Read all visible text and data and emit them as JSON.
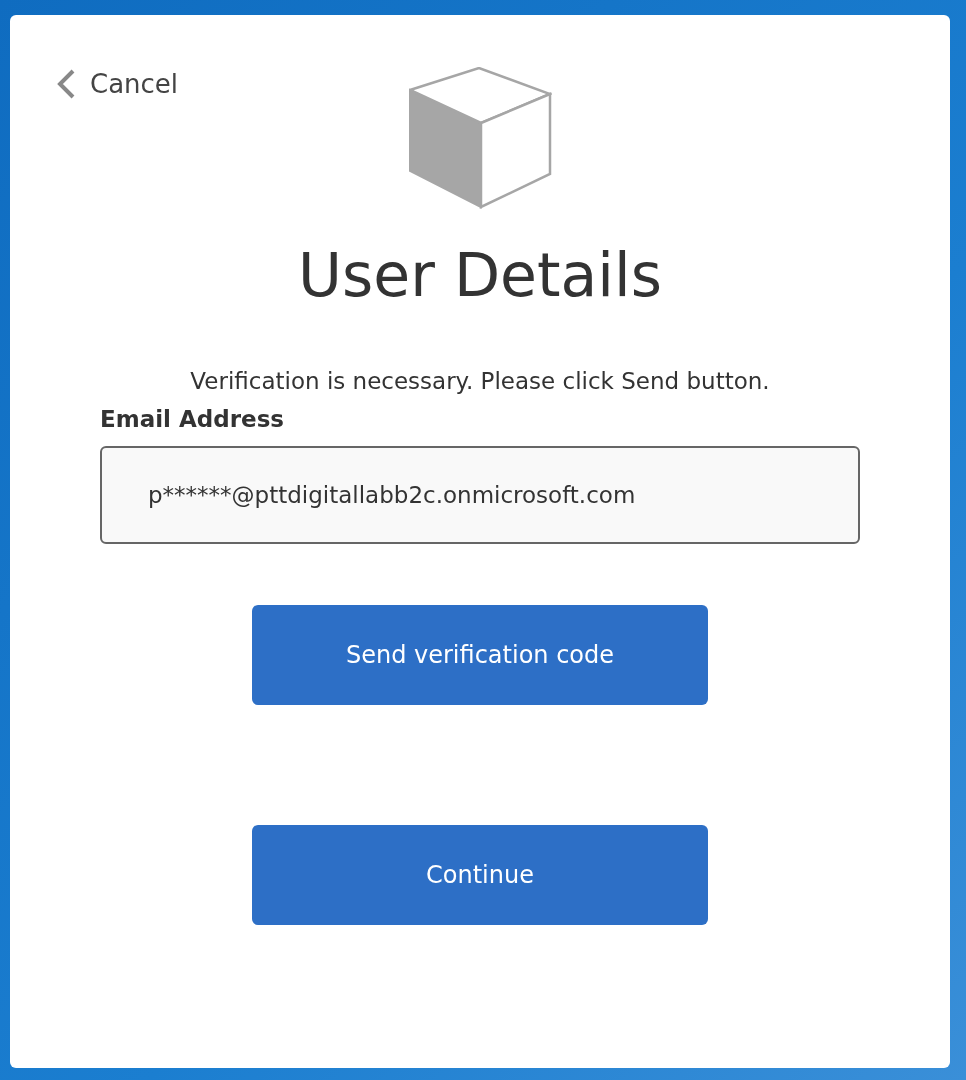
{
  "cancel": {
    "label": "Cancel"
  },
  "title": "User Details",
  "message": "Verification is necessary. Please click Send button.",
  "email": {
    "label": "Email Address",
    "value": "p******@pttdigitallabb2c.onmicrosoft.com"
  },
  "buttons": [
    {
      "label": "Send verification code"
    },
    {
      "label": "Continue"
    }
  ]
}
